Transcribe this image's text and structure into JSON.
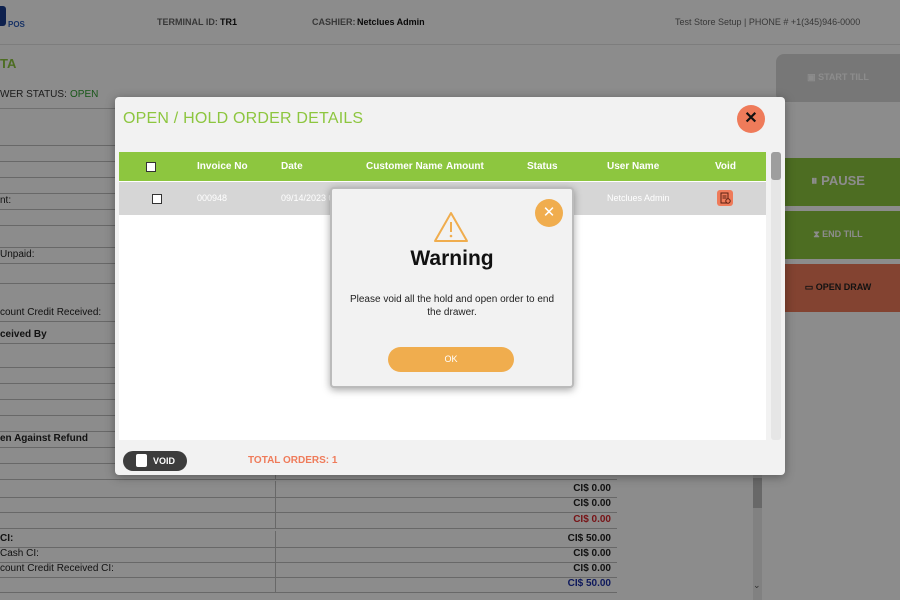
{
  "header": {
    "logo_text": "POS",
    "terminal_label": "TERMINAL ID:",
    "terminal_value": "TR1",
    "cashier_label": "CASHIER:",
    "cashier_value": "Netclues Admin",
    "store_info": "Test Store Setup | PHONE # +1(345)946-0000"
  },
  "page": {
    "title_fragment": "TA",
    "drawer_status_label": "WER STATUS:",
    "drawer_status_value": "OPEN"
  },
  "report_rows": [
    {
      "label": "",
      "value": ""
    },
    {
      "label": "",
      "value": ""
    },
    {
      "label": "",
      "value": ""
    },
    {
      "label": "",
      "value": ""
    },
    {
      "label": "nt:",
      "value": ""
    },
    {
      "label": "",
      "value": ""
    },
    {
      "label": "",
      "value": ""
    },
    {
      "label": "Unpaid:",
      "value": ""
    },
    {
      "label": "",
      "value": ""
    },
    {
      "label": "count Credit Received:",
      "value": ""
    },
    {
      "label": "ceived By",
      "value": ""
    },
    {
      "label": "",
      "value": ""
    },
    {
      "label": "",
      "value": ""
    },
    {
      "label": "",
      "value": ""
    },
    {
      "label": "",
      "value": ""
    },
    {
      "label": "",
      "value": ""
    },
    {
      "label": "en Against Refund",
      "value": ""
    },
    {
      "label": "",
      "value": ""
    },
    {
      "label": "",
      "value": ""
    },
    {
      "label": "",
      "value": "CI$ 0.00"
    },
    {
      "label": "",
      "value": "CI$ 0.00"
    },
    {
      "label": "",
      "value": "CI$ 0.00"
    },
    {
      "label": "CI:",
      "value": "CI$ 50.00"
    },
    {
      "label": "Cash CI:",
      "value": "CI$ 0.00"
    },
    {
      "label": "count Credit Received CI:",
      "value": "CI$ 0.00"
    },
    {
      "label": "",
      "value": "CI$ 50.00"
    }
  ],
  "right_panel": {
    "start_till": "START TILL",
    "pause": "PAUSE",
    "end_till": "END TILL",
    "open_drawer": "OPEN DRAW"
  },
  "modal": {
    "title": "OPEN / HOLD ORDER DETAILS",
    "close": "✕",
    "columns": [
      "Invoice No",
      "Date",
      "Customer Name",
      "Amount",
      "Status",
      "User Name",
      "Void"
    ],
    "rows": [
      {
        "invoice": "000948",
        "date": "09/14/2023 0",
        "customer": "",
        "amount": "",
        "status": "",
        "user": "Netclues Admin"
      }
    ],
    "void_button": "VOID",
    "total_orders": "TOTAL ORDERS: 1"
  },
  "warning": {
    "title": "Warning",
    "message": "Please void all the hold and open order to end the drawer.",
    "ok": "OK",
    "close": "✕"
  },
  "colors": {
    "brand_green": "#8dc63f",
    "accent_orange": "#ef7b5a",
    "warning_yellow": "#f0ad4e",
    "red_value": "#d9262b",
    "blue_value": "#1b2fa8"
  }
}
